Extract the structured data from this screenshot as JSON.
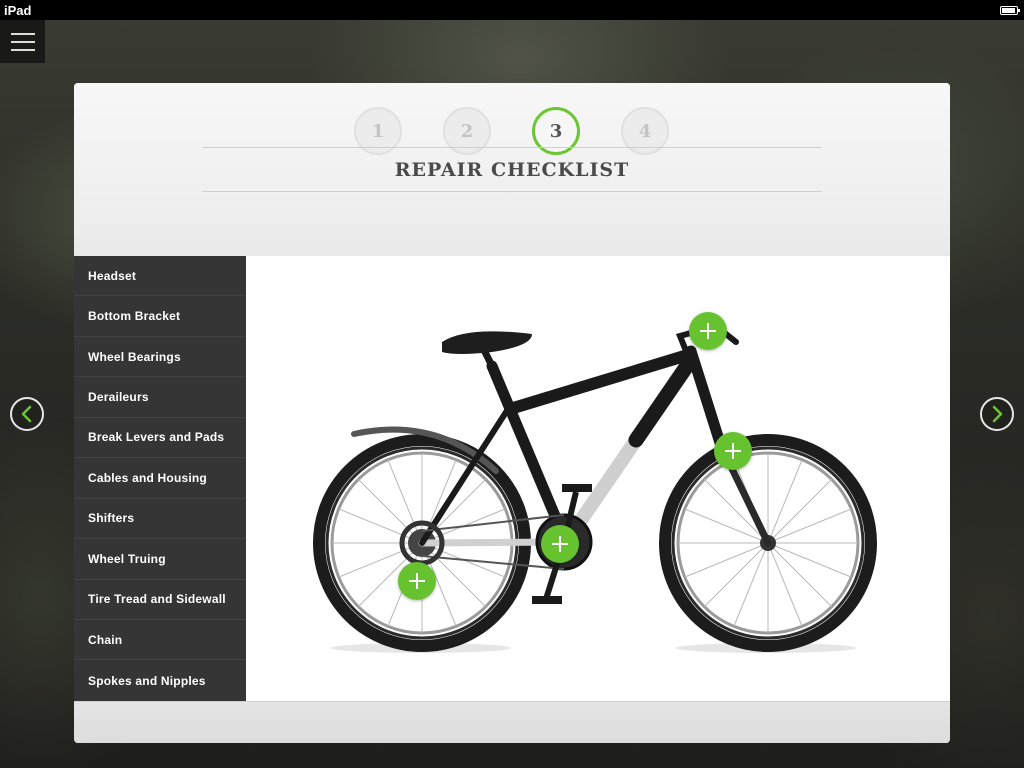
{
  "status_bar": {
    "device": "iPad"
  },
  "wizard": {
    "steps": [
      "1",
      "2",
      "3",
      "4"
    ],
    "active_step": "3",
    "title": "REPAIR CHECKLIST"
  },
  "sidebar": {
    "items": [
      {
        "label": "Headset"
      },
      {
        "label": "Bottom Bracket"
      },
      {
        "label": "Wheel Bearings"
      },
      {
        "label": "Deraileurs"
      },
      {
        "label": "Break Levers and Pads"
      },
      {
        "label": "Cables and Housing"
      },
      {
        "label": "Shifters"
      },
      {
        "label": "Wheel Truing"
      },
      {
        "label": "Tire Tread and Sidewall"
      },
      {
        "label": "Chain"
      },
      {
        "label": "Spokes and Nipples"
      }
    ]
  },
  "icons": {
    "menu": "hamburger-menu-icon",
    "prev": "chevron-left-icon",
    "next": "chevron-right-icon",
    "hotspot": "plus-icon"
  },
  "colors": {
    "accent": "#6cc531",
    "sidebar_bg": "#353535",
    "title_text": "#4a4a4a"
  }
}
